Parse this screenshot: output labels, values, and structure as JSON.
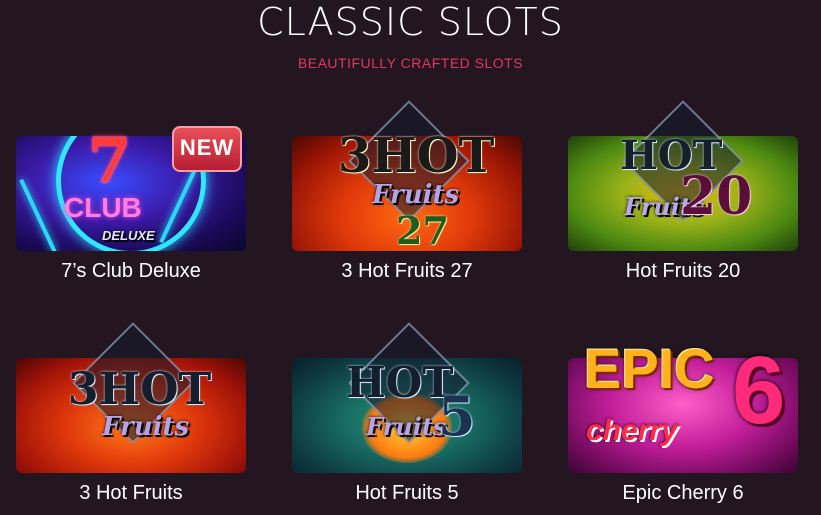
{
  "header": {
    "title": "CLASSIC SLOTS",
    "subtitle": "BEAUTIFULLY CRAFTED SLOTS"
  },
  "games": [
    {
      "name": "7’s Club Deluxe",
      "badge": "NEW",
      "logo_main": "7",
      "logo_sub": "CLUB",
      "logo_extra": "DELUXE"
    },
    {
      "name": "3 Hot Fruits 27",
      "logo_main": "3HOT",
      "logo_sub": "Fruits",
      "logo_extra": "27"
    },
    {
      "name": "Hot Fruits 20",
      "logo_main": "HOT",
      "logo_sub": "Fruits",
      "logo_extra": "20"
    },
    {
      "name": "3 Hot Fruits",
      "logo_main": "3HOT",
      "logo_sub": "Fruits"
    },
    {
      "name": "Hot Fruits 5",
      "logo_main": "HOT",
      "logo_sub": "Fruits",
      "logo_extra": "5"
    },
    {
      "name": "Epic Cherry 6",
      "logo_main": "EPIC",
      "logo_sub": "cherry",
      "logo_extra": "6"
    }
  ],
  "colors": {
    "background": "#231620",
    "subtitle": "#e5355e"
  }
}
